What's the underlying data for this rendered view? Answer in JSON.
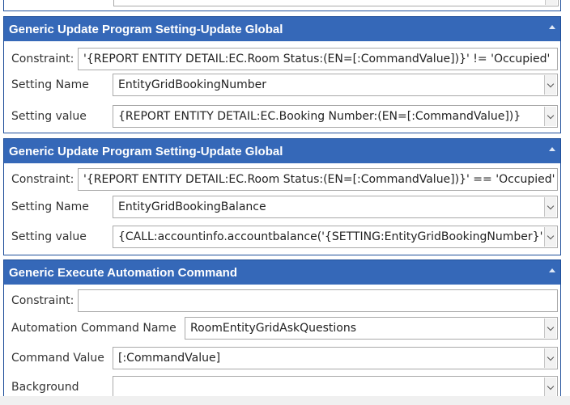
{
  "icons": {
    "collapse": "chevron-up-icon",
    "dropdown": "chevron-down-icon"
  },
  "colors": {
    "header_bg": "#3568b8",
    "header_text": "#ffffff",
    "panel_border": "#1f4f9a"
  },
  "panels": [
    {
      "title": "Generic Update Program Setting-Update Global",
      "constraint_label": "Constraint:",
      "constraint_value": "'{REPORT ENTITY DETAIL:EC.Room Status:(EN=[:CommandValue])}' != 'Occupied'",
      "setting_name_label": "Setting Name",
      "setting_name_value": "EntityGridBookingNumber",
      "setting_value_label": "Setting value",
      "setting_value_value": "{REPORT ENTITY DETAIL:EC.Booking Number:(EN=[:CommandValue])}"
    },
    {
      "title": "Generic Update Program Setting-Update Global",
      "constraint_label": "Constraint:",
      "constraint_value": "'{REPORT ENTITY DETAIL:EC.Room Status:(EN=[:CommandValue])}' == 'Occupied'",
      "setting_name_label": "Setting Name",
      "setting_name_value": "EntityGridBookingBalance",
      "setting_value_label": "Setting value",
      "setting_value_value": "{CALL:accountinfo.accountbalance('{SETTING:EntityGridBookingNumber}')}"
    },
    {
      "title": "Generic Execute Automation Command",
      "constraint_label": "Constraint:",
      "constraint_value": "",
      "automation_command_label": "Automation Command Name",
      "automation_command_value": "RoomEntityGridAskQuestions",
      "command_value_label": "Command Value",
      "command_value_value": "[:CommandValue]",
      "background_label": "Background",
      "background_value": ""
    }
  ]
}
